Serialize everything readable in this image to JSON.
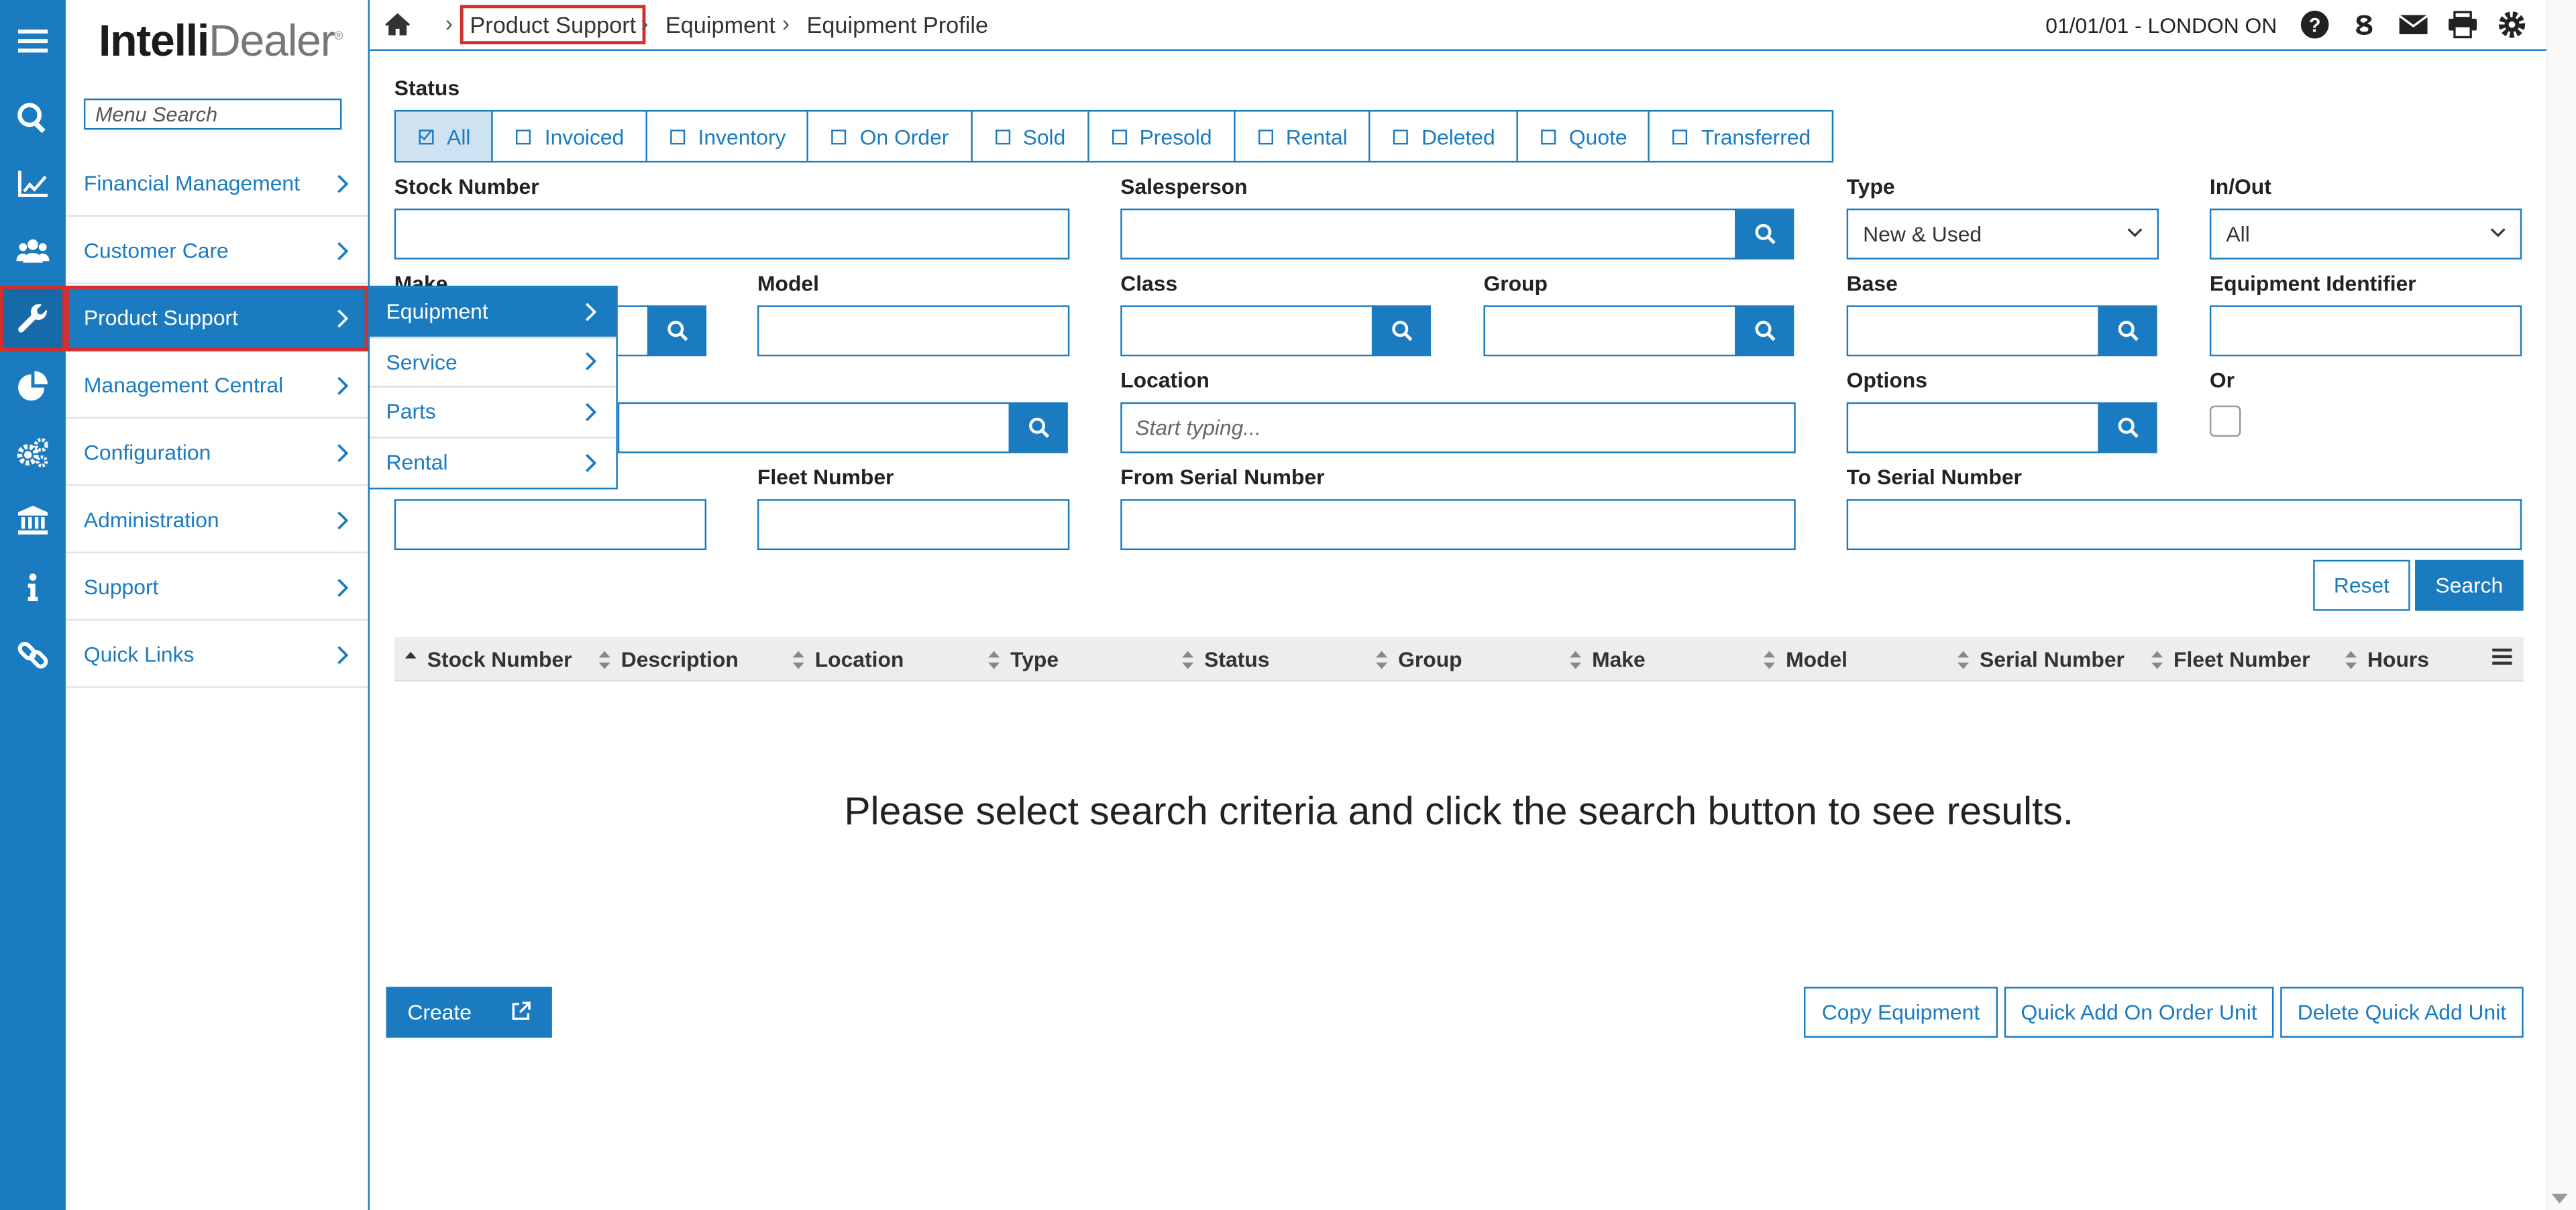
{
  "app": {
    "logo_main": "Intelli",
    "logo_rest": "Dealer",
    "menu_search_placeholder": "Menu Search"
  },
  "menu": {
    "items": [
      {
        "label": "Financial Management",
        "icon": "line-chart-icon"
      },
      {
        "label": "Customer Care",
        "icon": "users-icon"
      },
      {
        "label": "Product Support",
        "icon": "wrench-icon",
        "active": true
      },
      {
        "label": "Management Central",
        "icon": "pie-chart-icon"
      },
      {
        "label": "Configuration",
        "icon": "gears-icon"
      },
      {
        "label": "Administration",
        "icon": "bank-icon"
      },
      {
        "label": "Support",
        "icon": "info-icon"
      },
      {
        "label": "Quick Links",
        "icon": "link-icon"
      }
    ],
    "flyout": [
      {
        "label": "Equipment",
        "active": true
      },
      {
        "label": "Service"
      },
      {
        "label": "Parts"
      },
      {
        "label": "Rental"
      }
    ]
  },
  "breadcrumb": {
    "items": [
      "Product Support",
      "Equipment",
      "Equipment Profile"
    ],
    "separator": "›"
  },
  "topbar": {
    "location": "01/01/01 - LONDON ON",
    "icons": [
      "help-icon",
      "dollar-s-icon",
      "envelope-icon",
      "print-icon",
      "settings-icon"
    ]
  },
  "status": {
    "label": "Status",
    "options": [
      {
        "label": "All",
        "checked": true
      },
      {
        "label": "Invoiced"
      },
      {
        "label": "Inventory"
      },
      {
        "label": "On Order"
      },
      {
        "label": "Sold"
      },
      {
        "label": "Presold"
      },
      {
        "label": "Rental"
      },
      {
        "label": "Deleted"
      },
      {
        "label": "Quote"
      },
      {
        "label": "Transferred"
      }
    ]
  },
  "fields": {
    "stock_number": "Stock Number",
    "salesperson": "Salesperson",
    "type": "Type",
    "type_value": "New & Used",
    "in_out": "In/Out",
    "in_out_value": "All",
    "make": "Make",
    "model": "Model",
    "class": "Class",
    "group": "Group",
    "base": "Base",
    "equipment_identifier": "Equipment Identifier",
    "location": "Location",
    "location_placeholder": "Start typing...",
    "options": "Options",
    "or": "Or",
    "fleet_number": "Fleet Number",
    "from_serial": "From Serial Number",
    "to_serial": "To Serial Number"
  },
  "actions": {
    "reset": "Reset",
    "search": "Search",
    "create": "Create",
    "copy_equipment": "Copy Equipment",
    "quick_add": "Quick Add On Order Unit",
    "delete_quick_add": "Delete Quick Add Unit"
  },
  "table": {
    "columns": [
      "Stock Number",
      "Description",
      "Location",
      "Type",
      "Status",
      "Group",
      "Make",
      "Model",
      "Serial Number",
      "Fleet Number",
      "Hours"
    ],
    "empty_message": "Please select search criteria and click the search button to see results."
  },
  "colors": {
    "accent": "#1a7bc0",
    "highlight": "#d32f2f"
  }
}
